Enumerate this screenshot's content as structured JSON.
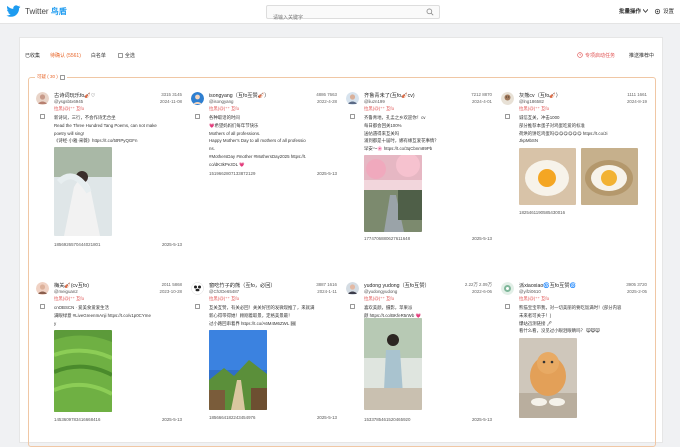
{
  "header": {
    "app_name": "Twitter",
    "app_name_cn": "鸟盾",
    "search_placeholder": "请输入关键字",
    "ops_label": "批量操作",
    "settings_label": "设置"
  },
  "toolbar": {
    "tabs": [
      "已收集",
      "待确认 (5561)",
      "白名单"
    ],
    "select_all": "全选",
    "task_label": "专项启动任务",
    "recommend_task": "推送推荐中"
  },
  "group": {
    "label": "可疑 ( 30 )"
  },
  "cards": [
    {
      "name": "古诗词玩乐fo🎻♡",
      "handle": "@ysgsbtx6945",
      "stats": "3315  3145",
      "date": "2024-11-08",
      "tags": "拉黑(@)⁺⁺ 互fo",
      "lines": [
        "新诗词，三行，不会作诗无合坐",
        "Read the Three Hundred Tang Poems, can not make",
        "poetry will sing!",
        "《诗经·小雅·采薇》https://t.co/5tRPyQGFn"
      ],
      "post_id": "1856926570444021801",
      "post_date": "2025-5-13"
    },
    {
      "name": "isongyang（互fo互赞🎻）",
      "handle": "@isongyang",
      "stats": "4886  7663",
      "date": "2022-4-28",
      "tags": "拉黑(@)⁺⁺ 互fo",
      "lines": [
        "各种取话的时间",
        "💗希望妈妈们每年节快乐",
        "Mothers of all professions.",
        "Happy Mother's Day to all mothers of all professio",
        "ns.",
        "#MothersDay #mother #MothersDay2025 https://t.",
        "co/dK3kPezDL 💗"
      ],
      "post_id": "1519662807133872129",
      "post_date": "2025-5-13"
    },
    {
      "name": "齐鲁青未了(互fo🎻cv)",
      "handle": "@liuzn199",
      "stats": "7212  8870",
      "date": "2024-4-01",
      "tags": "拉黑(@)⁺⁺ 互fo",
      "lines": [
        "齐鲁青地，孔孟之乡欢迎你！cv",
        "每日都会回关100%",
        "送帖遇得来互关吗",
        "涌到都是十届时，娜有缘互爱花事情？",
        "早安～🌸 https://t.co/3qCbnm89Pb"
      ],
      "post_id": "1774706880627611648",
      "post_date": "2025-5-13"
    },
    {
      "name": "灰熊cv（互fo🎻）",
      "handle": "@lng186582",
      "stats": "1111  1661",
      "date": "2024-8-19",
      "tags": "拉黑(@)⁺⁺ 互fo",
      "lines": [
        "诚信互关，冲击1000",
        "部分推荐本蛋子对鸡蛋吃爱的标准",
        "荷烘的饼吃鸡蛋吗😋😋😋😋😋😋 https://t.co/Ji",
        "JkpMbSN"
      ],
      "post_id": "1825461190585430016",
      "post_date": ""
    },
    {
      "name": "梅关🎻(cv互fo)",
      "handle": "@meiguan2",
      "stats": "2011  5868",
      "date": "2023-10-28",
      "tags": "拉黑(@)⁺⁺ 互fo",
      "lines": [
        "cnOBSCN · 爱美食爱爱生活",
        "满眼绿意 #LiveGreenInAnji https://t.co/v1p0CYme",
        "y"
      ],
      "post_id": "1453609783416668416",
      "post_date": "2025-5-13"
    },
    {
      "name": "窗吃竹子的熊（互fo，必回）",
      "handle": "@ChzDe65487",
      "stats": "3887  1616",
      "date": "2024-1-11",
      "tags": "拉黑(@)⁺⁺ 互fo",
      "lines": [
        "互关互赞，有关必回！关关好团的发微现推了，来就满",
        "新心得带得她！顾刚着取景，定格美景最！",
        "过小路回串着界 https://t.co/A6M4M6ZWL 🖼"
      ],
      "post_id": "1856664182243454976",
      "post_date": "2025-5-13"
    },
    {
      "name": "yudong yudong（互fo互赞）",
      "handle": "@yudongyudong",
      "stats": "2.22万  2.09万",
      "date": "2022-6-06",
      "tags": "拉黑(@)⁺⁺ 互fo",
      "lines": [
        "喜欢美颜，摄影，苹果派",
        "颜 https://t.co/BKfeR5rWb 💗"
      ],
      "post_id": "1533785461520465920",
      "post_date": "2025-5-13"
    },
    {
      "name": "派xiaoxiao🌀互fo互赞🌀",
      "handle": "@yifzi0610",
      "stats": "3905  3720",
      "date": "2025-2-05",
      "tags": "拉黑(@)⁺⁺ 互fo",
      "lines": [
        "熊猫宝宝带我，对一切美丽的要吃饭满时！(部分内容",
        "未来者可关于！)",
        "爆站迅测链接 🖊",
        "看什么看，没见过小眼泪眼睛吗？ 😸😸😸"
      ],
      "post_id": "",
      "post_date": ""
    }
  ],
  "colors": {
    "accent": "#e8662a",
    "tag_red": "#e05050",
    "brand_blue": "#1d9bf0"
  }
}
